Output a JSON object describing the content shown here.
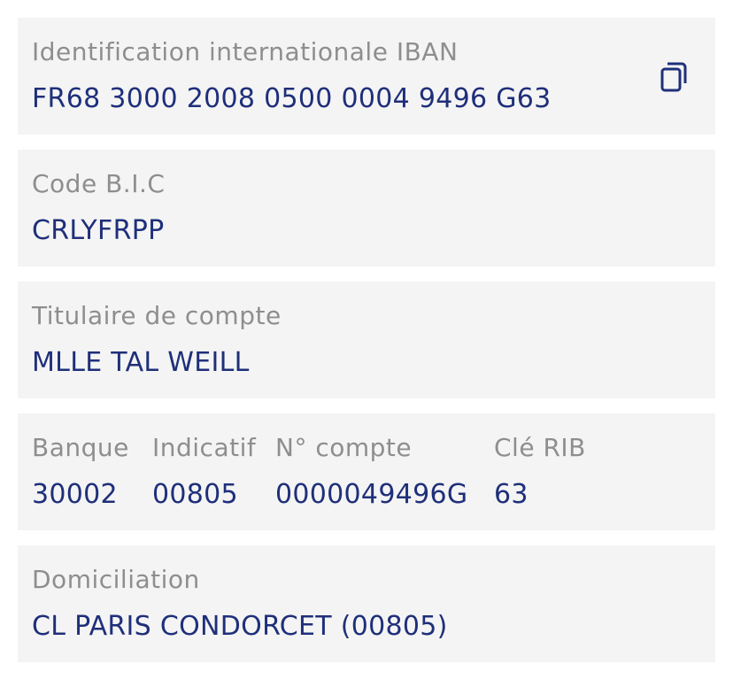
{
  "iban": {
    "label": "Identification internationale IBAN",
    "value": "FR68 3000 2008 0500 0004 9496 G63",
    "icon": "copy-icon"
  },
  "bic": {
    "label": "Code B.I.C",
    "value": "CRLYFRPP"
  },
  "holder": {
    "label": "Titulaire de compte",
    "value": "MLLE TAL WEILL"
  },
  "rib": {
    "bank": {
      "label": "Banque",
      "value": "30002"
    },
    "branch": {
      "label": "Indicatif",
      "value": "00805"
    },
    "account": {
      "label": "N° compte",
      "value": "0000049496G"
    },
    "key": {
      "label": "Clé RIB",
      "value": "63"
    }
  },
  "domiciliation": {
    "label": "Domiciliation",
    "value": "CL PARIS CONDORCET (00805)"
  },
  "colors": {
    "card_bg": "#f4f4f4",
    "label": "#8e8e8e",
    "value": "#1f2f7a"
  }
}
